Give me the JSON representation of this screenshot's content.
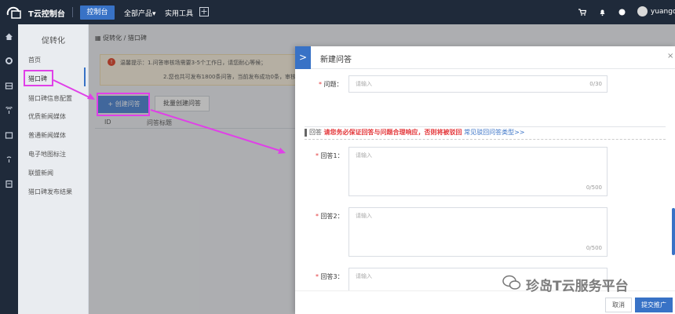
{
  "topbar": {
    "brand": "T云控制台",
    "console_btn": "控制台",
    "nav_products": "全部产品▾",
    "nav_tools": "实用工具",
    "plus": "+",
    "username": "yuango..."
  },
  "menu": {
    "title": "促转化",
    "items": [
      "首页",
      "猎口碑",
      "猎口碑信息配置",
      "优质新闻媒体",
      "普通新闻媒体",
      "电子地图标注",
      "联盟新闻",
      "猎口碑发布结果"
    ]
  },
  "main": {
    "breadcrumb": "促转化 / 猎口碑",
    "notice_line1": "温馨提示：1.问答审核场需要3-5个工作日，请您耐心等候；",
    "notice_line2": "2.您也共可发布1800条问答，当前发布成功0条，审核",
    "btn_create": "+ 创建问答",
    "btn_batch": "批量创建问答",
    "col_id": "ID",
    "col_title": "问答标题"
  },
  "panel": {
    "title": "新建问答",
    "close": "×",
    "chevron": ">",
    "question_label": "问题：",
    "question_placeholder": "请输入",
    "question_count": "0/30",
    "section_title": "回答",
    "section_warning": "请您务必保证回答与问题合理响应，否则将被驳回",
    "section_link": "常见驳回问答类型>>",
    "answers": [
      {
        "label": "回答1：",
        "placeholder": "请输入",
        "count": "0/500"
      },
      {
        "label": "回答2：",
        "placeholder": "请输入",
        "count": "0/500"
      },
      {
        "label": "回答3：",
        "placeholder": "请输入"
      }
    ],
    "cancel": "取消",
    "submit": "提交推广"
  },
  "watermark": "珍岛T云服务平台",
  "colors": {
    "topbar": "#1f2a3a",
    "accent": "#3872c6",
    "highlight": "#e040e8",
    "warning": "#e4393c"
  }
}
